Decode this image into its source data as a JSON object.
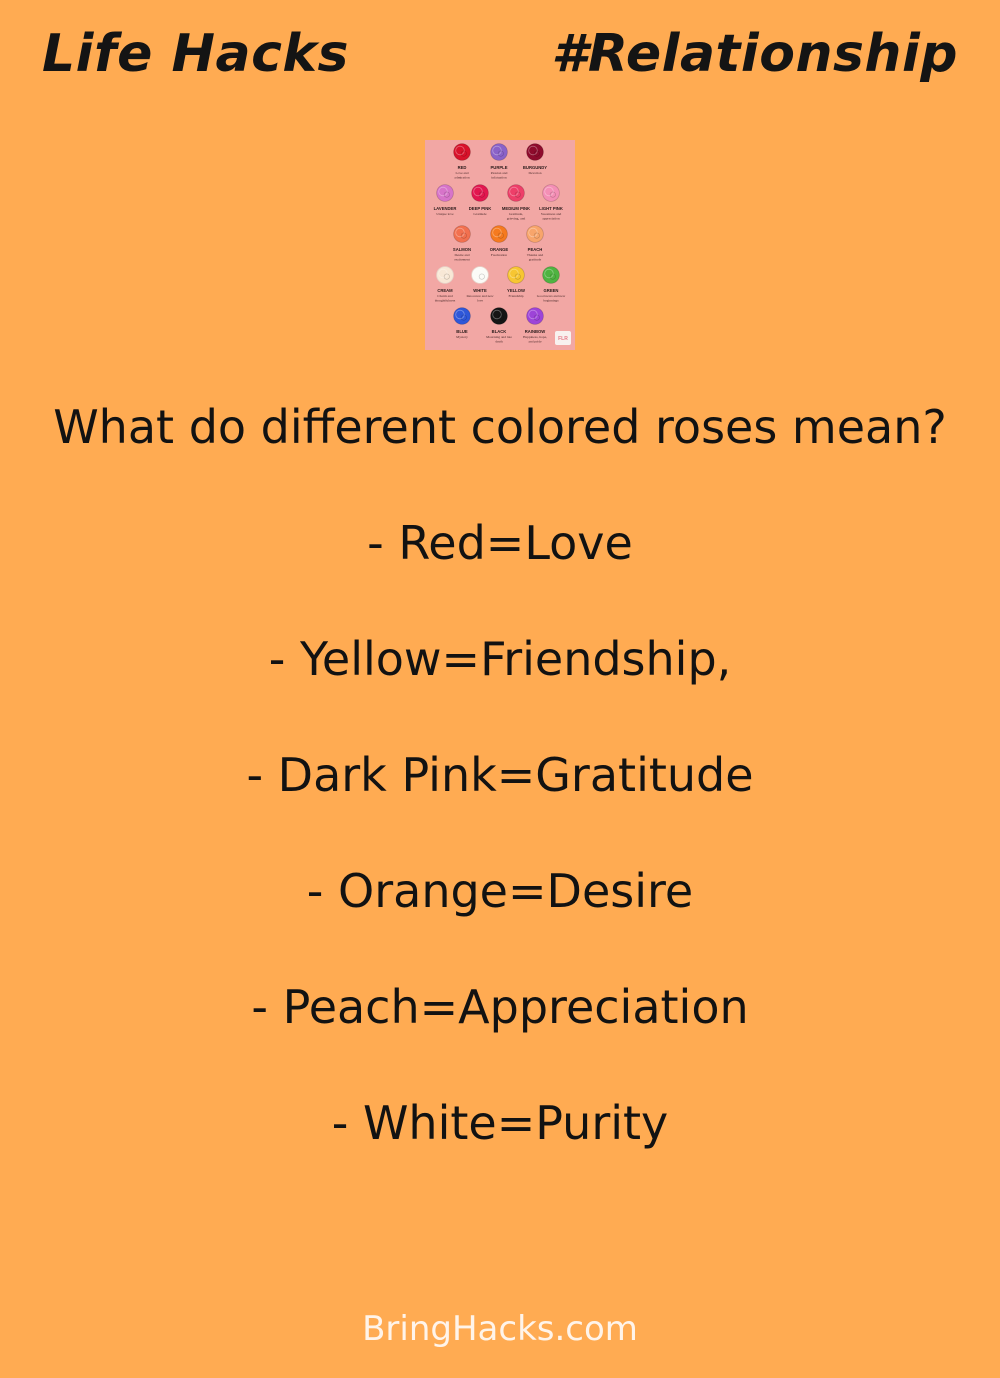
{
  "header": {
    "left_title": "Life Hacks",
    "right_tag": "#Relationship"
  },
  "rose_chart": {
    "background_color": "#f2a7a4",
    "logo_text": "FLR",
    "roses": [
      {
        "name": "RED",
        "meaning": "Love and admiration",
        "color": "#d8122a"
      },
      {
        "name": "PURPLE",
        "meaning": "Passion and infatuation",
        "color": "#8a62c8"
      },
      {
        "name": "BURGUNDY",
        "meaning": "Devotion",
        "color": "#8e0b2c"
      },
      {
        "name": "LAVENDER",
        "meaning": "Unique love",
        "color": "#d774c9"
      },
      {
        "name": "DEEP PINK",
        "meaning": "Gratitude",
        "color": "#e2174f"
      },
      {
        "name": "MEDIUM PINK",
        "meaning": "Gratitude, grieving, and congratulations",
        "color": "#ee3f69"
      },
      {
        "name": "LIGHT PINK",
        "meaning": "Sweetness and appreciation",
        "color": "#f48fb5"
      },
      {
        "name": "SALMON",
        "meaning": "Desire and excitement",
        "color": "#f2704f"
      },
      {
        "name": "ORANGE",
        "meaning": "Fascination",
        "color": "#f57a1f"
      },
      {
        "name": "PEACH",
        "meaning": "Thanks and gratitude",
        "color": "#f8a56b"
      },
      {
        "name": "CREAM",
        "meaning": "Charm and thoughtfulness",
        "color": "#f8e8d6"
      },
      {
        "name": "WHITE",
        "meaning": "Innocence and new love",
        "color": "#fbfbf7"
      },
      {
        "name": "YELLOW",
        "meaning": "Friendship",
        "color": "#f7c632"
      },
      {
        "name": "GREEN",
        "meaning": "Good news and new beginnings",
        "color": "#4fb341"
      },
      {
        "name": "BLUE",
        "meaning": "Mystery",
        "color": "#2f57d8"
      },
      {
        "name": "BLACK",
        "meaning": "Mourning and late death",
        "color": "#151515"
      },
      {
        "name": "RAINBOW",
        "meaning": "Happiness, hope, and pride",
        "color": "#9d44d8"
      }
    ]
  },
  "content": {
    "question": "What do different colored roses mean?",
    "meanings": [
      "- Red=Love",
      "- Yellow=Friendship,",
      "- Dark Pink=Gratitude",
      "- Orange=Desire",
      "- Peach=Appreciation",
      "- White=Purity"
    ]
  },
  "footer": {
    "site": "BringHacks.com"
  },
  "colors": {
    "background": "#ffab52",
    "text": "#121212",
    "footer_text": "#fff4ea"
  }
}
